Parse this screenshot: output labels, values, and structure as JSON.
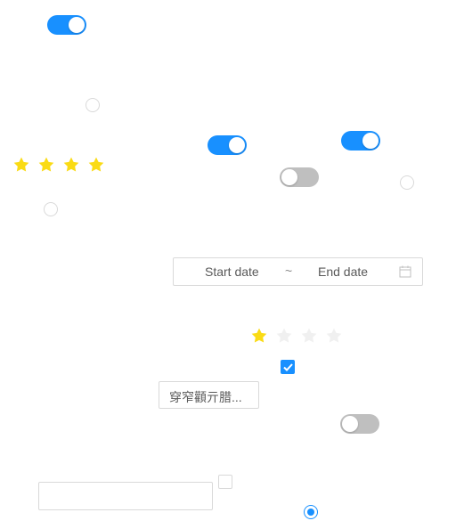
{
  "colors": {
    "primary": "#1890ff",
    "switch_off": "#bfbfbf",
    "star_filled": "#fadb14",
    "star_empty": "#f0f0f0",
    "border": "#d9d9d9"
  },
  "switches": [
    {
      "id": "switch-1",
      "checked": true
    },
    {
      "id": "switch-2",
      "checked": true
    },
    {
      "id": "switch-3",
      "checked": true
    },
    {
      "id": "switch-4",
      "checked": false
    },
    {
      "id": "switch-5",
      "checked": false
    }
  ],
  "radios": [
    {
      "id": "radio-1",
      "checked": false
    },
    {
      "id": "radio-2",
      "checked": false
    },
    {
      "id": "radio-3",
      "checked": false
    },
    {
      "id": "radio-4",
      "checked": true
    }
  ],
  "checkboxes": [
    {
      "id": "checkbox-1",
      "checked": true
    },
    {
      "id": "checkbox-2",
      "checked": false
    }
  ],
  "ratings": [
    {
      "id": "rating-1",
      "value": 4,
      "count": 4
    },
    {
      "id": "rating-2",
      "value": 1,
      "count": 4
    }
  ],
  "range_picker": {
    "start_placeholder": "Start date",
    "separator": "~",
    "end_placeholder": "End date",
    "icon": "calendar-icon"
  },
  "select": {
    "value": "穿窄顴亓腊..."
  },
  "text_input": {
    "value": ""
  }
}
